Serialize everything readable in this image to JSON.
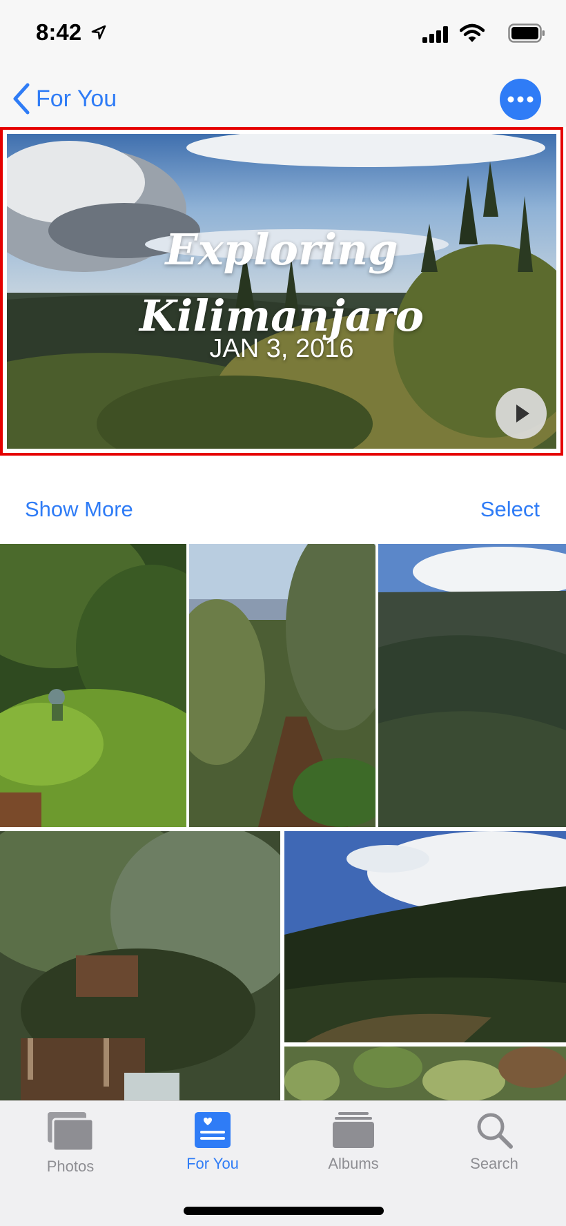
{
  "status_bar": {
    "time": "8:42",
    "icons": [
      "location-arrow-icon",
      "cellular-signal-icon",
      "wifi-icon",
      "battery-icon"
    ]
  },
  "nav": {
    "back_label": "For You",
    "back_icon": "chevron-left-icon",
    "more_icon": "ellipsis-icon"
  },
  "hero": {
    "title_line1": "Exploring",
    "title_line2": "Kilimanjaro",
    "date": "JAN 3, 2016",
    "play_icon": "play-icon"
  },
  "links": {
    "show_more": "Show More",
    "select": "Select"
  },
  "photos": [
    {
      "name": "photo-forest-hikers"
    },
    {
      "name": "photo-trail-path"
    },
    {
      "name": "photo-mountain-ridge"
    },
    {
      "name": "photo-bridge-stream"
    },
    {
      "name": "photo-valley-clouds"
    },
    {
      "name": "photo-plants-closeup"
    }
  ],
  "tab_bar": {
    "tabs": [
      {
        "label": "Photos",
        "icon": "photos-stack-icon",
        "active": false
      },
      {
        "label": "For You",
        "icon": "for-you-heart-icon",
        "active": true
      },
      {
        "label": "Albums",
        "icon": "albums-icon",
        "active": false
      },
      {
        "label": "Search",
        "icon": "search-icon",
        "active": false
      }
    ]
  },
  "colors": {
    "accent": "#2f7cf6",
    "highlight_border": "#e50000",
    "inactive_tab": "#8e8e93"
  }
}
